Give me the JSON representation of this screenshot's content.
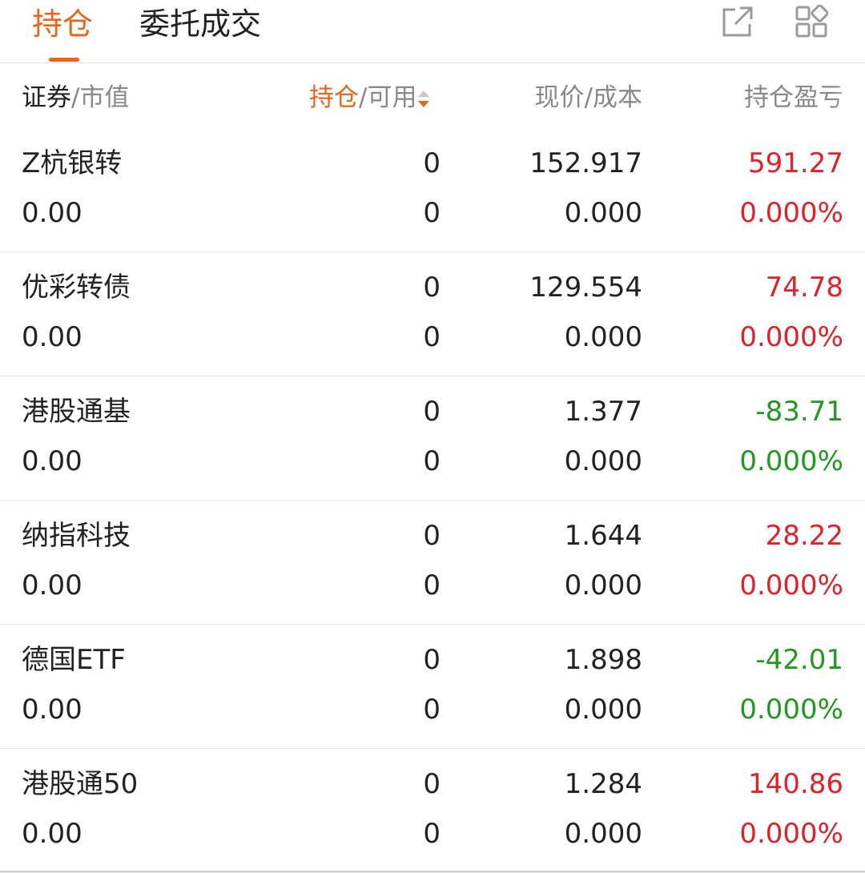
{
  "tabs": {
    "active_label": "持仓",
    "inactive_label": "委托成交"
  },
  "toolbar": {
    "icons": [
      "external-open-icon",
      "grid-layout-icon"
    ]
  },
  "colors": {
    "accent": "#e8641b",
    "gain": "#e0202b",
    "loss": "#1f9a1f",
    "muted": "#888888"
  },
  "header": {
    "col1_a": "证券",
    "col1_sep": "/",
    "col1_b": "市值",
    "col2_a": "持仓",
    "col2_sep": "/",
    "col2_b": "可用",
    "col3": "现价/成本",
    "col4": "持仓盈亏",
    "sort_direction": "descending"
  },
  "holdings": [
    {
      "name": "Z杭银转",
      "market_value": "0.00",
      "position": "0",
      "available": "0",
      "price": "152.917",
      "cost": "0.000",
      "pl": "591.27",
      "pl_pct": "0.000%",
      "trend": "up"
    },
    {
      "name": "优彩转债",
      "market_value": "0.00",
      "position": "0",
      "available": "0",
      "price": "129.554",
      "cost": "0.000",
      "pl": "74.78",
      "pl_pct": "0.000%",
      "trend": "up"
    },
    {
      "name": "港股通基",
      "market_value": "0.00",
      "position": "0",
      "available": "0",
      "price": "1.377",
      "cost": "0.000",
      "pl": "-83.71",
      "pl_pct": "0.000%",
      "trend": "down"
    },
    {
      "name": "纳指科技",
      "market_value": "0.00",
      "position": "0",
      "available": "0",
      "price": "1.644",
      "cost": "0.000",
      "pl": "28.22",
      "pl_pct": "0.000%",
      "trend": "up"
    },
    {
      "name": "德国ETF",
      "market_value": "0.00",
      "position": "0",
      "available": "0",
      "price": "1.898",
      "cost": "0.000",
      "pl": "-42.01",
      "pl_pct": "0.000%",
      "trend": "down"
    },
    {
      "name": "港股通50",
      "market_value": "0.00",
      "position": "0",
      "available": "0",
      "price": "1.284",
      "cost": "0.000",
      "pl": "140.86",
      "pl_pct": "0.000%",
      "trend": "up"
    }
  ]
}
